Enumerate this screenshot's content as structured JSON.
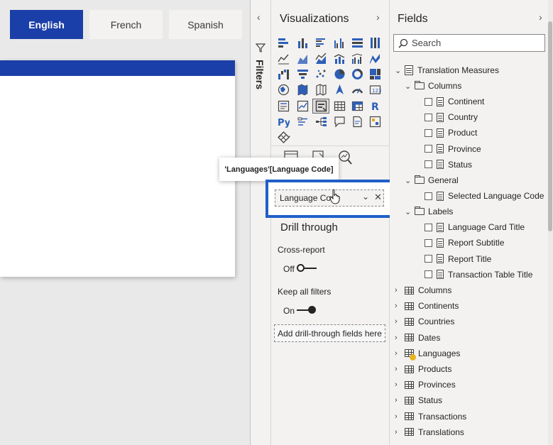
{
  "tabs": [
    {
      "label": "English",
      "active": true
    },
    {
      "label": "French",
      "active": false
    },
    {
      "label": "Spanish",
      "active": false
    }
  ],
  "filters_label": "Filters",
  "visualizations": {
    "title": "Visualizations",
    "more_label": "···",
    "tooltip": "'Languages'[Language Code]",
    "field_well_value": "Language Code",
    "drill_through": {
      "title": "Drill through",
      "cross_report_label": "Cross-report",
      "cross_report_state": "Off",
      "keep_filters_label": "Keep all filters",
      "keep_filters_state": "On",
      "add_fields_label": "Add drill-through fields here"
    }
  },
  "fields": {
    "title": "Fields",
    "search_placeholder": "Search",
    "tree": {
      "root": "Translation Measures",
      "folders": [
        {
          "name": "Columns",
          "items": [
            "Continent",
            "Country",
            "Product",
            "Province",
            "Status"
          ]
        },
        {
          "name": "General",
          "items": [
            "Selected Language Code"
          ]
        },
        {
          "name": "Labels",
          "items": [
            "Language Card Title",
            "Report Subtitle",
            "Report Title",
            "Transaction Table Title"
          ]
        }
      ],
      "tables": [
        "Columns",
        "Continents",
        "Countries",
        "Dates",
        "Languages",
        "Products",
        "Provinces",
        "Status",
        "Transactions",
        "Translations"
      ]
    }
  },
  "colors": {
    "accent": "#1b3fa8",
    "highlight": "#1f5fc8",
    "pane_bg": "#f3f2f1"
  },
  "icons": [
    "stacked-bar-icon",
    "stacked-column-icon",
    "clustered-bar-icon",
    "clustered-column-icon",
    "100-bar-icon",
    "100-column-icon",
    "line-icon",
    "area-icon",
    "stacked-area-icon",
    "line-column-icon",
    "line-clustered-column-icon",
    "ribbon-icon",
    "waterfall-icon",
    "funnel-icon",
    "scatter-icon",
    "pie-icon",
    "donut-icon",
    "treemap-icon",
    "map-icon",
    "filled-map-icon",
    "shape-map-icon",
    "azure-map-icon",
    "gauge-icon",
    "card-icon",
    "multi-row-card-icon",
    "kpi-icon",
    "slicer-icon",
    "table-icon",
    "matrix-icon",
    "r-visual-icon",
    "python-visual-icon",
    "key-influencers-icon",
    "decomposition-tree-icon",
    "qna-icon",
    "smart-narrative-icon",
    "paginated-report-icon",
    "power-apps-icon",
    "more-visuals-icon"
  ]
}
